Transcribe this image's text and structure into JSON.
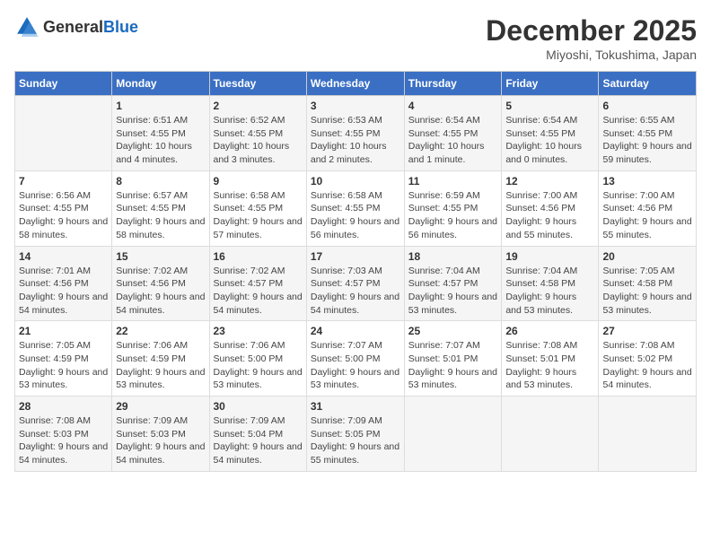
{
  "logo": {
    "text_general": "General",
    "text_blue": "Blue"
  },
  "header": {
    "month_year": "December 2025",
    "location": "Miyoshi, Tokushima, Japan"
  },
  "weekdays": [
    "Sunday",
    "Monday",
    "Tuesday",
    "Wednesday",
    "Thursday",
    "Friday",
    "Saturday"
  ],
  "weeks": [
    [
      {
        "day": "",
        "sunrise": "",
        "sunset": "",
        "daylight": ""
      },
      {
        "day": "1",
        "sunrise": "Sunrise: 6:51 AM",
        "sunset": "Sunset: 4:55 PM",
        "daylight": "Daylight: 10 hours and 4 minutes."
      },
      {
        "day": "2",
        "sunrise": "Sunrise: 6:52 AM",
        "sunset": "Sunset: 4:55 PM",
        "daylight": "Daylight: 10 hours and 3 minutes."
      },
      {
        "day": "3",
        "sunrise": "Sunrise: 6:53 AM",
        "sunset": "Sunset: 4:55 PM",
        "daylight": "Daylight: 10 hours and 2 minutes."
      },
      {
        "day": "4",
        "sunrise": "Sunrise: 6:54 AM",
        "sunset": "Sunset: 4:55 PM",
        "daylight": "Daylight: 10 hours and 1 minute."
      },
      {
        "day": "5",
        "sunrise": "Sunrise: 6:54 AM",
        "sunset": "Sunset: 4:55 PM",
        "daylight": "Daylight: 10 hours and 0 minutes."
      },
      {
        "day": "6",
        "sunrise": "Sunrise: 6:55 AM",
        "sunset": "Sunset: 4:55 PM",
        "daylight": "Daylight: 9 hours and 59 minutes."
      }
    ],
    [
      {
        "day": "7",
        "sunrise": "Sunrise: 6:56 AM",
        "sunset": "Sunset: 4:55 PM",
        "daylight": "Daylight: 9 hours and 58 minutes."
      },
      {
        "day": "8",
        "sunrise": "Sunrise: 6:57 AM",
        "sunset": "Sunset: 4:55 PM",
        "daylight": "Daylight: 9 hours and 58 minutes."
      },
      {
        "day": "9",
        "sunrise": "Sunrise: 6:58 AM",
        "sunset": "Sunset: 4:55 PM",
        "daylight": "Daylight: 9 hours and 57 minutes."
      },
      {
        "day": "10",
        "sunrise": "Sunrise: 6:58 AM",
        "sunset": "Sunset: 4:55 PM",
        "daylight": "Daylight: 9 hours and 56 minutes."
      },
      {
        "day": "11",
        "sunrise": "Sunrise: 6:59 AM",
        "sunset": "Sunset: 4:55 PM",
        "daylight": "Daylight: 9 hours and 56 minutes."
      },
      {
        "day": "12",
        "sunrise": "Sunrise: 7:00 AM",
        "sunset": "Sunset: 4:56 PM",
        "daylight": "Daylight: 9 hours and 55 minutes."
      },
      {
        "day": "13",
        "sunrise": "Sunrise: 7:00 AM",
        "sunset": "Sunset: 4:56 PM",
        "daylight": "Daylight: 9 hours and 55 minutes."
      }
    ],
    [
      {
        "day": "14",
        "sunrise": "Sunrise: 7:01 AM",
        "sunset": "Sunset: 4:56 PM",
        "daylight": "Daylight: 9 hours and 54 minutes."
      },
      {
        "day": "15",
        "sunrise": "Sunrise: 7:02 AM",
        "sunset": "Sunset: 4:56 PM",
        "daylight": "Daylight: 9 hours and 54 minutes."
      },
      {
        "day": "16",
        "sunrise": "Sunrise: 7:02 AM",
        "sunset": "Sunset: 4:57 PM",
        "daylight": "Daylight: 9 hours and 54 minutes."
      },
      {
        "day": "17",
        "sunrise": "Sunrise: 7:03 AM",
        "sunset": "Sunset: 4:57 PM",
        "daylight": "Daylight: 9 hours and 54 minutes."
      },
      {
        "day": "18",
        "sunrise": "Sunrise: 7:04 AM",
        "sunset": "Sunset: 4:57 PM",
        "daylight": "Daylight: 9 hours and 53 minutes."
      },
      {
        "day": "19",
        "sunrise": "Sunrise: 7:04 AM",
        "sunset": "Sunset: 4:58 PM",
        "daylight": "Daylight: 9 hours and 53 minutes."
      },
      {
        "day": "20",
        "sunrise": "Sunrise: 7:05 AM",
        "sunset": "Sunset: 4:58 PM",
        "daylight": "Daylight: 9 hours and 53 minutes."
      }
    ],
    [
      {
        "day": "21",
        "sunrise": "Sunrise: 7:05 AM",
        "sunset": "Sunset: 4:59 PM",
        "daylight": "Daylight: 9 hours and 53 minutes."
      },
      {
        "day": "22",
        "sunrise": "Sunrise: 7:06 AM",
        "sunset": "Sunset: 4:59 PM",
        "daylight": "Daylight: 9 hours and 53 minutes."
      },
      {
        "day": "23",
        "sunrise": "Sunrise: 7:06 AM",
        "sunset": "Sunset: 5:00 PM",
        "daylight": "Daylight: 9 hours and 53 minutes."
      },
      {
        "day": "24",
        "sunrise": "Sunrise: 7:07 AM",
        "sunset": "Sunset: 5:00 PM",
        "daylight": "Daylight: 9 hours and 53 minutes."
      },
      {
        "day": "25",
        "sunrise": "Sunrise: 7:07 AM",
        "sunset": "Sunset: 5:01 PM",
        "daylight": "Daylight: 9 hours and 53 minutes."
      },
      {
        "day": "26",
        "sunrise": "Sunrise: 7:08 AM",
        "sunset": "Sunset: 5:01 PM",
        "daylight": "Daylight: 9 hours and 53 minutes."
      },
      {
        "day": "27",
        "sunrise": "Sunrise: 7:08 AM",
        "sunset": "Sunset: 5:02 PM",
        "daylight": "Daylight: 9 hours and 54 minutes."
      }
    ],
    [
      {
        "day": "28",
        "sunrise": "Sunrise: 7:08 AM",
        "sunset": "Sunset: 5:03 PM",
        "daylight": "Daylight: 9 hours and 54 minutes."
      },
      {
        "day": "29",
        "sunrise": "Sunrise: 7:09 AM",
        "sunset": "Sunset: 5:03 PM",
        "daylight": "Daylight: 9 hours and 54 minutes."
      },
      {
        "day": "30",
        "sunrise": "Sunrise: 7:09 AM",
        "sunset": "Sunset: 5:04 PM",
        "daylight": "Daylight: 9 hours and 54 minutes."
      },
      {
        "day": "31",
        "sunrise": "Sunrise: 7:09 AM",
        "sunset": "Sunset: 5:05 PM",
        "daylight": "Daylight: 9 hours and 55 minutes."
      },
      {
        "day": "",
        "sunrise": "",
        "sunset": "",
        "daylight": ""
      },
      {
        "day": "",
        "sunrise": "",
        "sunset": "",
        "daylight": ""
      },
      {
        "day": "",
        "sunrise": "",
        "sunset": "",
        "daylight": ""
      }
    ]
  ]
}
